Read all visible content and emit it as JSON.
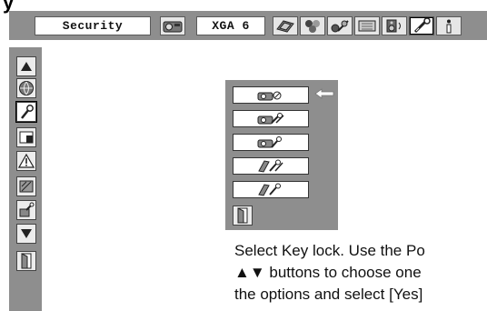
{
  "header": {
    "top_glyph": "y"
  },
  "menubar": {
    "security_label": "Security",
    "mode_label": "XGA 6",
    "tabs": [
      {
        "icon": "projector-image-icon"
      },
      {
        "icon": "pc-adjust-icon"
      },
      {
        "icon": "image-select-icon"
      },
      {
        "icon": "image-adjust-icon"
      },
      {
        "icon": "screen-icon"
      },
      {
        "icon": "sound-icon"
      },
      {
        "icon": "setting-icon",
        "active": true
      },
      {
        "icon": "information-icon"
      }
    ]
  },
  "sidebar": {
    "items": [
      {
        "icon": "up-arrow-icon"
      },
      {
        "icon": "language-icon"
      },
      {
        "icon": "setting-wrench-icon",
        "active": true
      },
      {
        "icon": "screen-adjust-icon"
      },
      {
        "icon": "warning-icon"
      },
      {
        "icon": "filter-icon"
      },
      {
        "icon": "key-lock-icon"
      },
      {
        "icon": "down-arrow-icon"
      },
      {
        "icon": "exit-door-icon"
      }
    ]
  },
  "submenu": {
    "items": [
      {
        "icon": "lock-off-icon",
        "selected": true
      },
      {
        "icon": "projector-lock-icon"
      },
      {
        "icon": "projector-key-lock-icon"
      },
      {
        "icon": "remote-key-lock-icon"
      },
      {
        "icon": "remote-lock-icon"
      }
    ],
    "exit_icon": "exit-door-icon"
  },
  "instructions": {
    "line1": "Select Key lock. Use the Po",
    "line2": "▲▼ buttons to choose one",
    "line3": "the options and select [Yes]"
  }
}
